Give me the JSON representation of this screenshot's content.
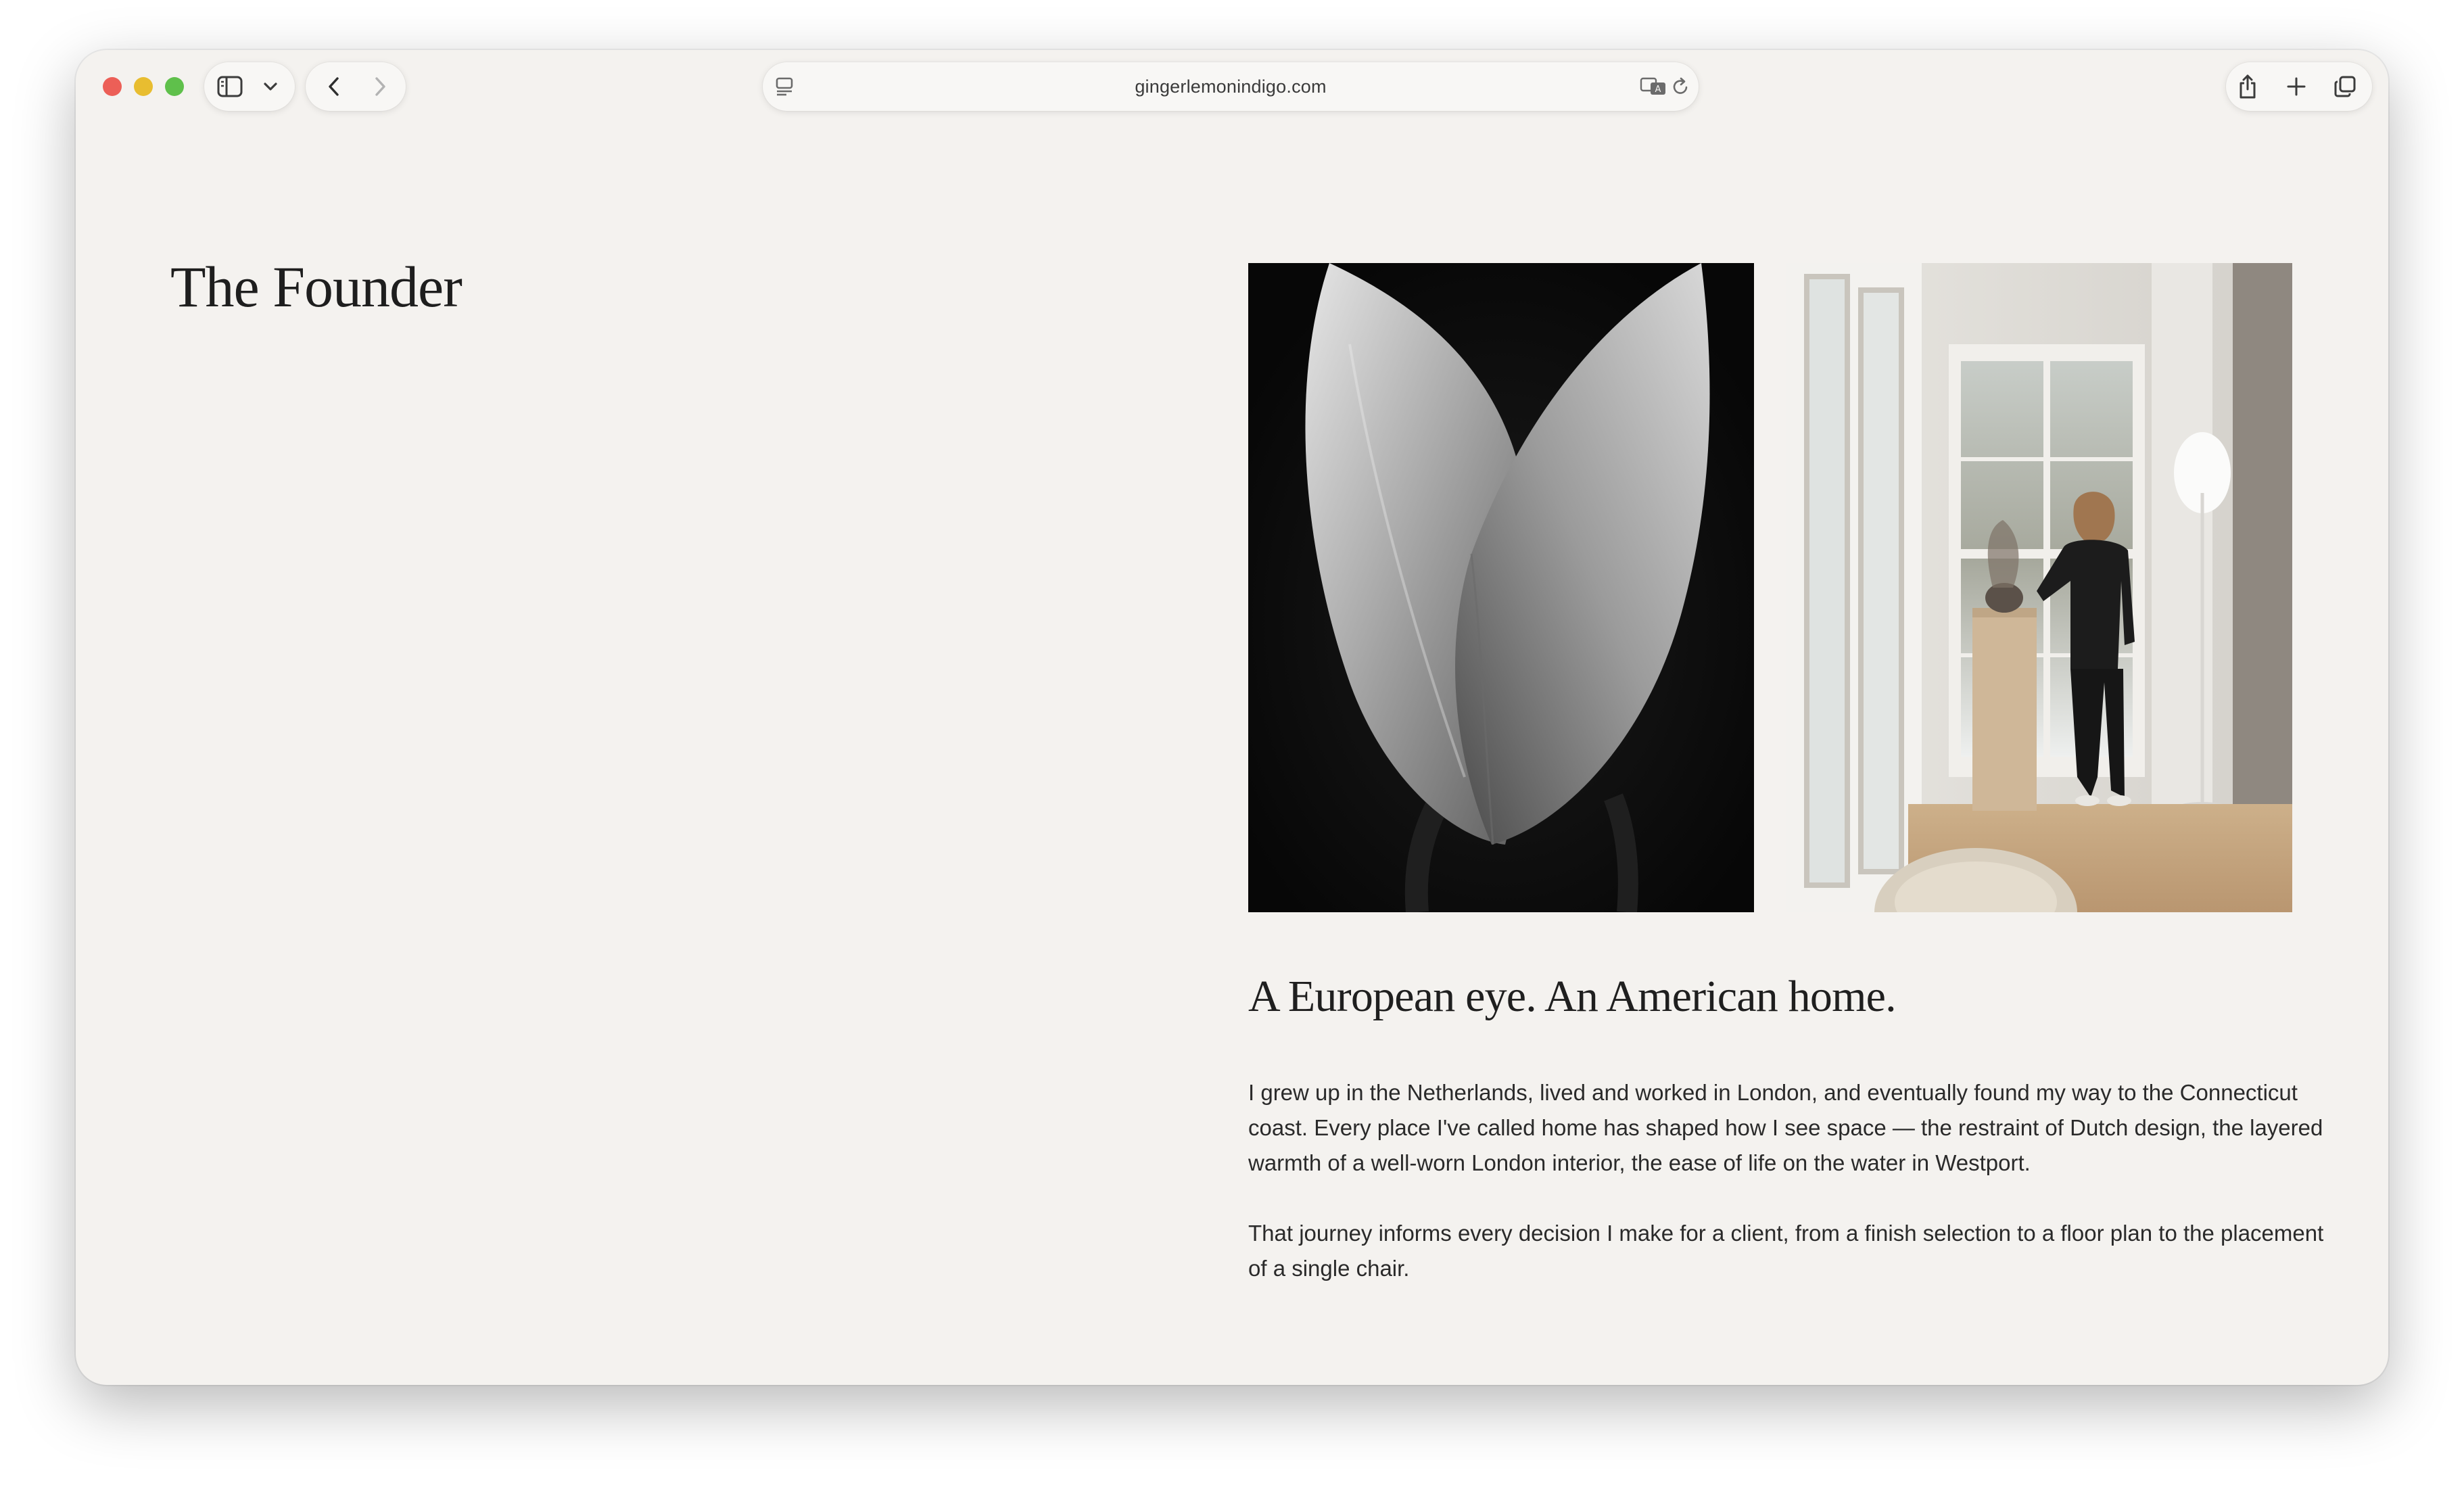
{
  "browser": {
    "url": "gingerlemonindigo.com"
  },
  "page": {
    "title": "The Founder",
    "heading": "A European eye. An American home.",
    "paragraphs": [
      "I grew up in the Netherlands, lived and worked in London, and eventually found my way to the Connecticut coast. Every place I've called home has shaped how I see space — the restraint of Dutch design, the layered warmth of a well-worn London interior, the ease of life on the water in Westport.",
      "That journey informs every decision I make for a client, from a finish selection to a floor plan to the placement of a single chair."
    ]
  },
  "icons": {
    "toolbar": [
      "sidebar-icon",
      "chevron-down-icon",
      "back-icon",
      "forward-icon",
      "reader-icon",
      "translate-icon",
      "reload-icon",
      "share-icon",
      "new-tab-icon",
      "tab-overview-icon"
    ]
  },
  "colors": {
    "page_background": "#f4f2ef",
    "close": "#ec5f57",
    "minimize": "#e8bd30",
    "zoom": "#5fc04b"
  }
}
